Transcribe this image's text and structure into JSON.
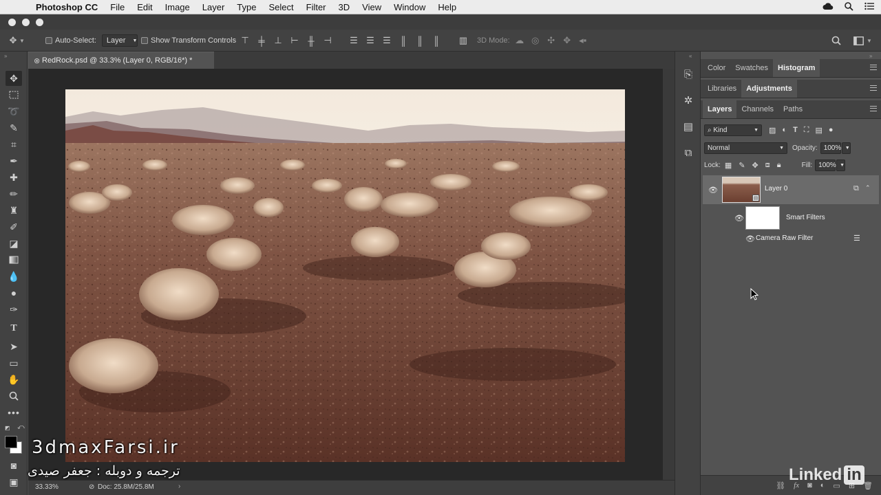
{
  "menubar": {
    "app_name": "Photoshop CC",
    "items": [
      "File",
      "Edit",
      "Image",
      "Layer",
      "Type",
      "Select",
      "Filter",
      "3D",
      "View",
      "Window",
      "Help"
    ]
  },
  "options": {
    "auto_select_label": "Auto-Select:",
    "auto_select_value": "Layer",
    "show_transform_label": "Show Transform Controls",
    "mode_3d_label": "3D Mode:"
  },
  "document": {
    "tab_title": "RedRock.psd @ 33.3% (Layer 0, RGB/16*) *"
  },
  "status": {
    "zoom": "33.33%",
    "doc_info": "Doc: 25.8M/25.8M"
  },
  "panels": {
    "row1_tabs": [
      "Color",
      "Swatches",
      "Histogram"
    ],
    "row1_active": "Histogram",
    "row2_tabs": [
      "Libraries",
      "Adjustments"
    ],
    "row2_active": "Adjustments",
    "row3_tabs": [
      "Layers",
      "Channels",
      "Paths"
    ],
    "row3_active": "Layers"
  },
  "layers": {
    "filter_kind": "Kind",
    "blend_mode": "Normal",
    "opacity_label": "Opacity:",
    "opacity_value": "100%",
    "lock_label": "Lock:",
    "fill_label": "Fill:",
    "fill_value": "100%",
    "layer_name": "Layer 0",
    "smart_filters_label": "Smart Filters",
    "filter_name": "Camera Raw Filter"
  },
  "watermark": {
    "site": "3dmaxFarsi.ir",
    "credit": "ترجمه و دوبله : جعفر صیدی"
  },
  "brand": {
    "name": "Linked",
    "suffix": "in"
  }
}
